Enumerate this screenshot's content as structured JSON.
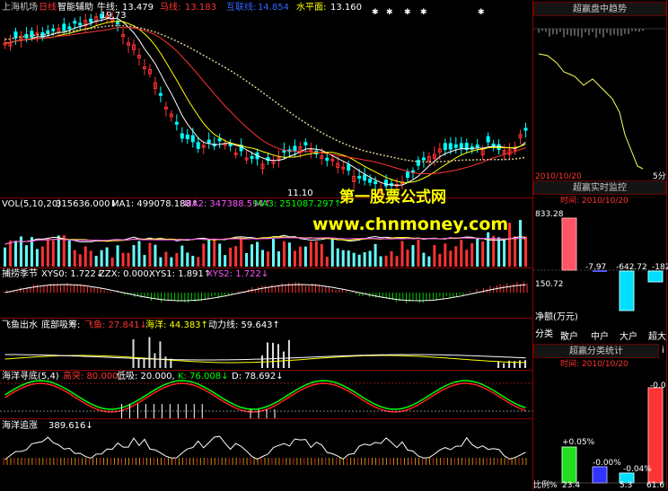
{
  "header": {
    "stock_name": "上海机场",
    "period": "日线",
    "indicator": "智能辅助",
    "ma1_label": "牛线:",
    "ma1_value": "13.479",
    "ma2_label": "马线:",
    "ma2_value": "13.183",
    "ma3_label": "互联线:",
    "ma3_value": "14.854",
    "ma4_label": "水平面:",
    "ma4_value": "13.160"
  },
  "main_chart": {
    "high_label": "19.73",
    "low_label": "11.10"
  },
  "vol_panel": {
    "title": "VOL(5,10,20)",
    "vol_value": "315636.000↓",
    "ma1": "MA1: 499078.188↑",
    "ma2": "MA2: 347388.594↑",
    "ma3": "MA3: 251087.297↑"
  },
  "season_panel": {
    "title": "捕捞季节",
    "xys0": "XYS0: 1.722↓",
    "zzx": "ZZX: 0.000,",
    "xys1": "XYS1: 1.891↑",
    "xys2": "XYS2: 1.722↓"
  },
  "fish_panel": {
    "title": "飞鱼出水",
    "sub": "底部吸筹:",
    "feiyu": "飞鱼: 27.841↓",
    "haiyang": "海洋: 44.383↑",
    "dongli": "动力线: 59.643↑"
  },
  "bottom_panel": {
    "title": "海洋寻底(5,4)",
    "gaoji": "高突: 80.000,",
    "diji": "低吸: 20.000,",
    "k": "K: 76.008↓",
    "d": "D: 78.692↓"
  },
  "chase_panel": {
    "title": "海洋追涨",
    "value": "389.616↓"
  },
  "watermark": {
    "line1": "第一股票公式网",
    "line2": "www.chnmoney.com"
  },
  "right_panels": {
    "trend_title": "超赢盘中趋势",
    "trend_date": "2010/10/20",
    "trend_tag": "5分",
    "monitor_title": "超赢实时监控",
    "monitor_time": "时间: 2010/10/20",
    "monitor_top": "833.28",
    "monitor_labels": [
      "-7.97",
      "-642.72",
      "-182"
    ],
    "monitor_scale": "150.72",
    "monitor_net": "净额(万元)",
    "categories_label": "分类",
    "categories": [
      "散户",
      "中户",
      "大户",
      "超大"
    ],
    "stats_title": "超赢分类统计",
    "stats_time": "时间: 2010/10/20",
    "stats_values": [
      "+0.05%",
      "-0.00%",
      "-0.04%",
      "-0.0"
    ],
    "stats_ratio_label": "比例%",
    "stats_bottom": [
      "23.4",
      "5.3",
      "61.6"
    ],
    "stats_tab": "i"
  },
  "colors": {
    "background": "#000000",
    "border": "#880000",
    "up_candle": "#ff3333",
    "down_candle": "#00ffff",
    "ma_yellow": "#ffff00",
    "ma_red": "#ff3333",
    "green": "#00ff00"
  }
}
